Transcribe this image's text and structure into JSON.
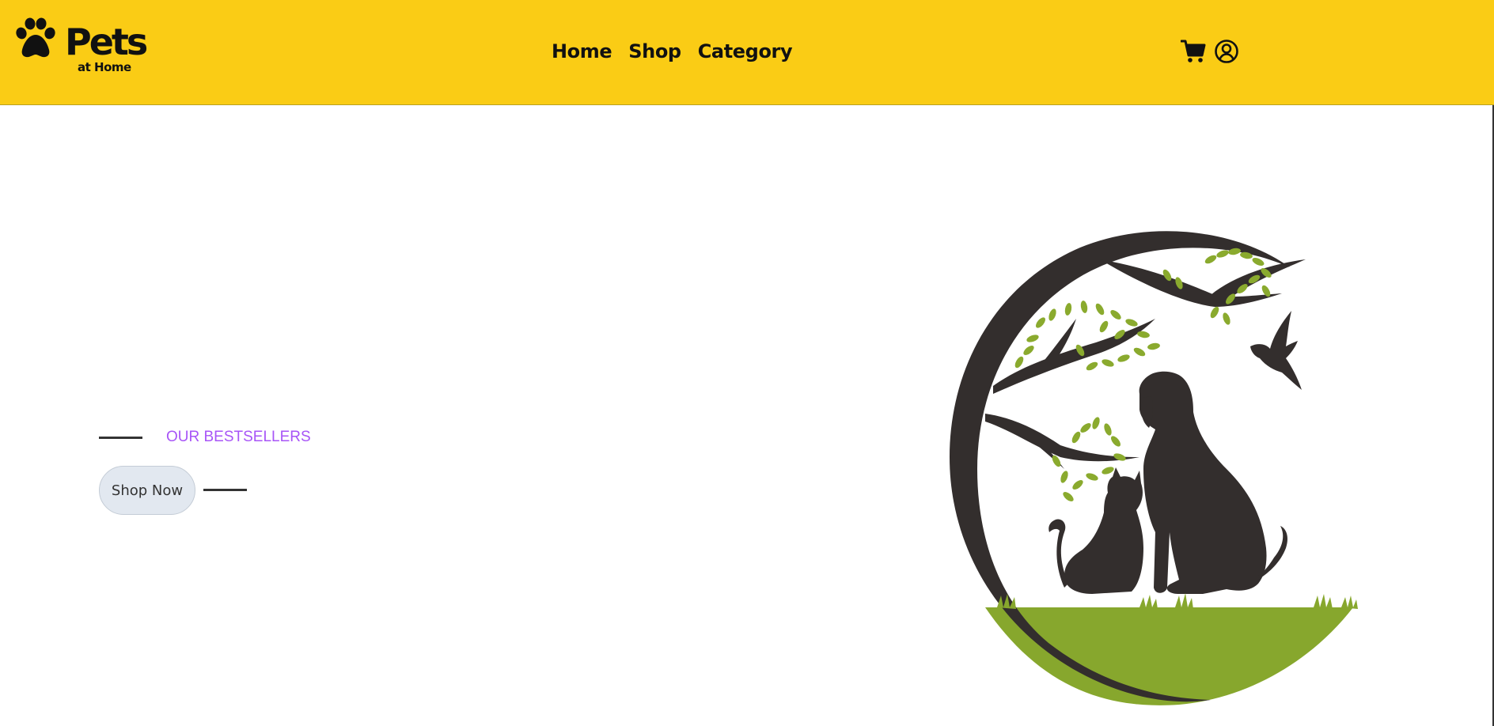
{
  "brand": {
    "name": "Pets",
    "subtitle": "at Home",
    "icon": "paw-icon"
  },
  "nav": {
    "items": [
      {
        "label": "Home"
      },
      {
        "label": "Shop"
      },
      {
        "label": "Category"
      }
    ]
  },
  "header_icons": {
    "cart": "cart-icon",
    "account": "user-circle-icon"
  },
  "hero": {
    "eyebrow": "OUR BESTSELLERS",
    "cta_label": "Shop Now",
    "illustration": "pets-tree-illustration"
  },
  "colors": {
    "header_bg": "#facc15",
    "text_dark": "#111111",
    "eyebrow": "#a855f7",
    "button_bg": "#e2e8f0",
    "tree_dark": "#332e2d",
    "leaf_green": "#8aaa2e",
    "grass_green": "#87a72d"
  }
}
